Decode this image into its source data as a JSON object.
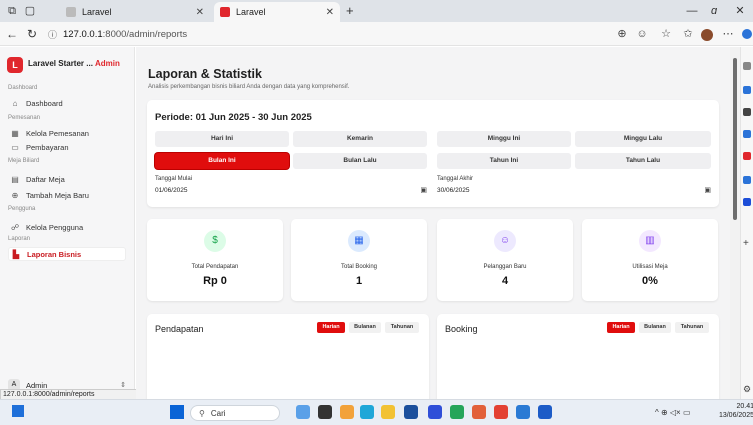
{
  "browser": {
    "tabs": [
      {
        "title": "Laravel",
        "active": false
      },
      {
        "title": "Laravel",
        "active": true
      }
    ],
    "new_tab": "+",
    "url_host": "127.0.0.1",
    "url_rest": ":8000/admin/reports",
    "status_url": "127.0.0.1:8000/admin/reports"
  },
  "sidebar": {
    "brand": "Laravel Starter ...",
    "role": "Admin",
    "sections": [
      {
        "label": "Dashboard",
        "items": [
          {
            "label": "Dashboard",
            "icon": "home-icon",
            "active": false
          }
        ]
      },
      {
        "label": "Pemesanan",
        "items": [
          {
            "label": "Kelola Pemesanan",
            "icon": "calendar-icon",
            "active": false
          },
          {
            "label": "Pembayaran",
            "icon": "credit-card-icon",
            "active": false
          }
        ]
      },
      {
        "label": "Meja Biliard",
        "items": [
          {
            "label": "Daftar Meja",
            "icon": "table-icon",
            "active": false
          },
          {
            "label": "Tambah Meja Baru",
            "icon": "plus-circle-icon",
            "active": false
          }
        ]
      },
      {
        "label": "Pengguna",
        "items": [
          {
            "label": "Kelola Pengguna",
            "icon": "users-icon",
            "active": false
          }
        ]
      },
      {
        "label": "Laporan",
        "items": [
          {
            "label": "Laporan Bisnis",
            "icon": "chart-icon",
            "active": true
          }
        ]
      }
    ],
    "user_initial": "A",
    "user_name": "Admin"
  },
  "main": {
    "title": "Laporan & Statistik",
    "subtitle": "Analisis perkembangan bisnis biliard Anda dengan data yang komprehensif.",
    "period_title": "Periode: 01 Jun 2025 - 30 Jun 2025",
    "period_buttons": [
      {
        "label": "Hari Ini",
        "active": false
      },
      {
        "label": "Kemarin",
        "active": false
      },
      {
        "label": "Minggu Ini",
        "active": false
      },
      {
        "label": "Minggu Lalu",
        "active": false
      },
      {
        "label": "Bulan Ini",
        "active": true
      },
      {
        "label": "Bulan Lalu",
        "active": false
      },
      {
        "label": "Tahun Ini",
        "active": false
      },
      {
        "label": "Tahun Lalu",
        "active": false
      }
    ],
    "start_label": "Tanggal Mulai",
    "start_value": "01/06/2025",
    "end_label": "Tanggal Akhir",
    "end_value": "30/06/2025",
    "stats": [
      {
        "label": "Total Pendapatan",
        "value": "Rp 0",
        "icon": "dollar-icon",
        "color": "#16a34a",
        "bg": "#dcfce7"
      },
      {
        "label": "Total Booking",
        "value": "1",
        "icon": "calendar-icon",
        "color": "#2563eb",
        "bg": "#dbeafe"
      },
      {
        "label": "Pelanggan Baru",
        "value": "4",
        "icon": "user-plus-icon",
        "color": "#7c3aed",
        "bg": "#ede9fe"
      },
      {
        "label": "Utilisasi Meja",
        "value": "0%",
        "icon": "bar-chart-icon",
        "color": "#7c3aed",
        "bg": "#f3e8ff"
      }
    ],
    "panels": [
      {
        "title": "Pendapatan",
        "segments": [
          "Harian",
          "Bulanan",
          "Tahunan"
        ],
        "active": 0
      },
      {
        "title": "Booking",
        "segments": [
          "Harian",
          "Bulanan",
          "Tahunan"
        ],
        "active": 0
      }
    ]
  },
  "taskbar": {
    "search": "Cari",
    "time": "20.41",
    "date": "13/06/2025"
  },
  "colors": {
    "accent": "#e00d0d",
    "brand": "#e0272d"
  }
}
